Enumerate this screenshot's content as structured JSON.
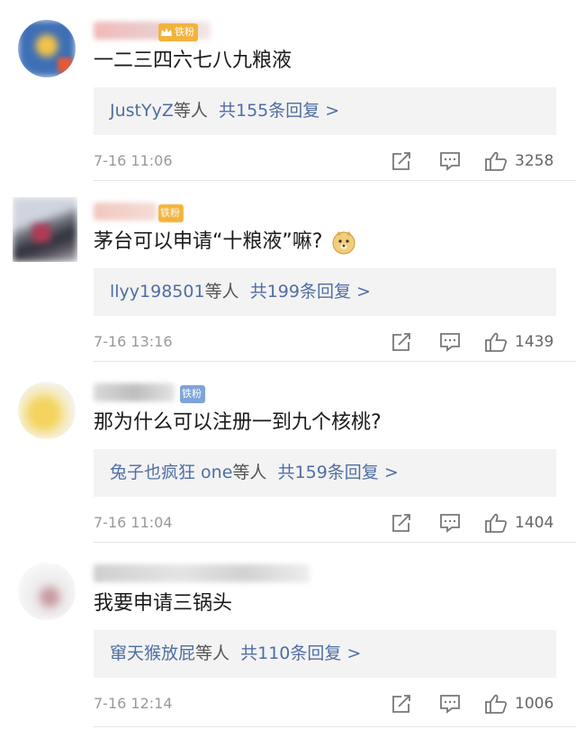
{
  "badge_label": "铁粉",
  "comments": [
    {
      "username": "",
      "content": "一二三四六七八九粮液",
      "reply_user": "JustYyZ",
      "reply_etc": "等人",
      "reply_count": "共155条回复 >",
      "time": "7-16 11:06",
      "likes": "3258",
      "has_emoji": false
    },
    {
      "username": "",
      "content": "茅台可以申请“十粮液”嘛?",
      "reply_user": "llyy198501",
      "reply_etc": "等人",
      "reply_count": "共199条回复 >",
      "time": "7-16 13:16",
      "likes": "1439",
      "has_emoji": true,
      "emoji_name": "doge-emoji"
    },
    {
      "username": "",
      "content": "那为什么可以注册一到九个核桃?",
      "reply_user": "兔子也疯狂 one",
      "reply_etc": "等人",
      "reply_count": "共159条回复 >",
      "time": "7-16 11:04",
      "likes": "1404",
      "has_emoji": false
    },
    {
      "username": "",
      "content": "我要申请三锅头",
      "reply_user": "窜天猴放屁",
      "reply_etc": "等人",
      "reply_count": "共110条回复 >",
      "time": "7-16 12:14",
      "likes": "1006",
      "has_emoji": false
    }
  ],
  "icons": {
    "share": "share-icon",
    "comment": "comment-icon",
    "like": "thumbs-up-icon"
  },
  "colors": {
    "reply_link": "#4f6ea3",
    "reply_bg": "#f3f3f3",
    "badge_gold": "#f2b33d",
    "badge_blue": "#7fa4d9",
    "meta_gray": "#999999"
  }
}
